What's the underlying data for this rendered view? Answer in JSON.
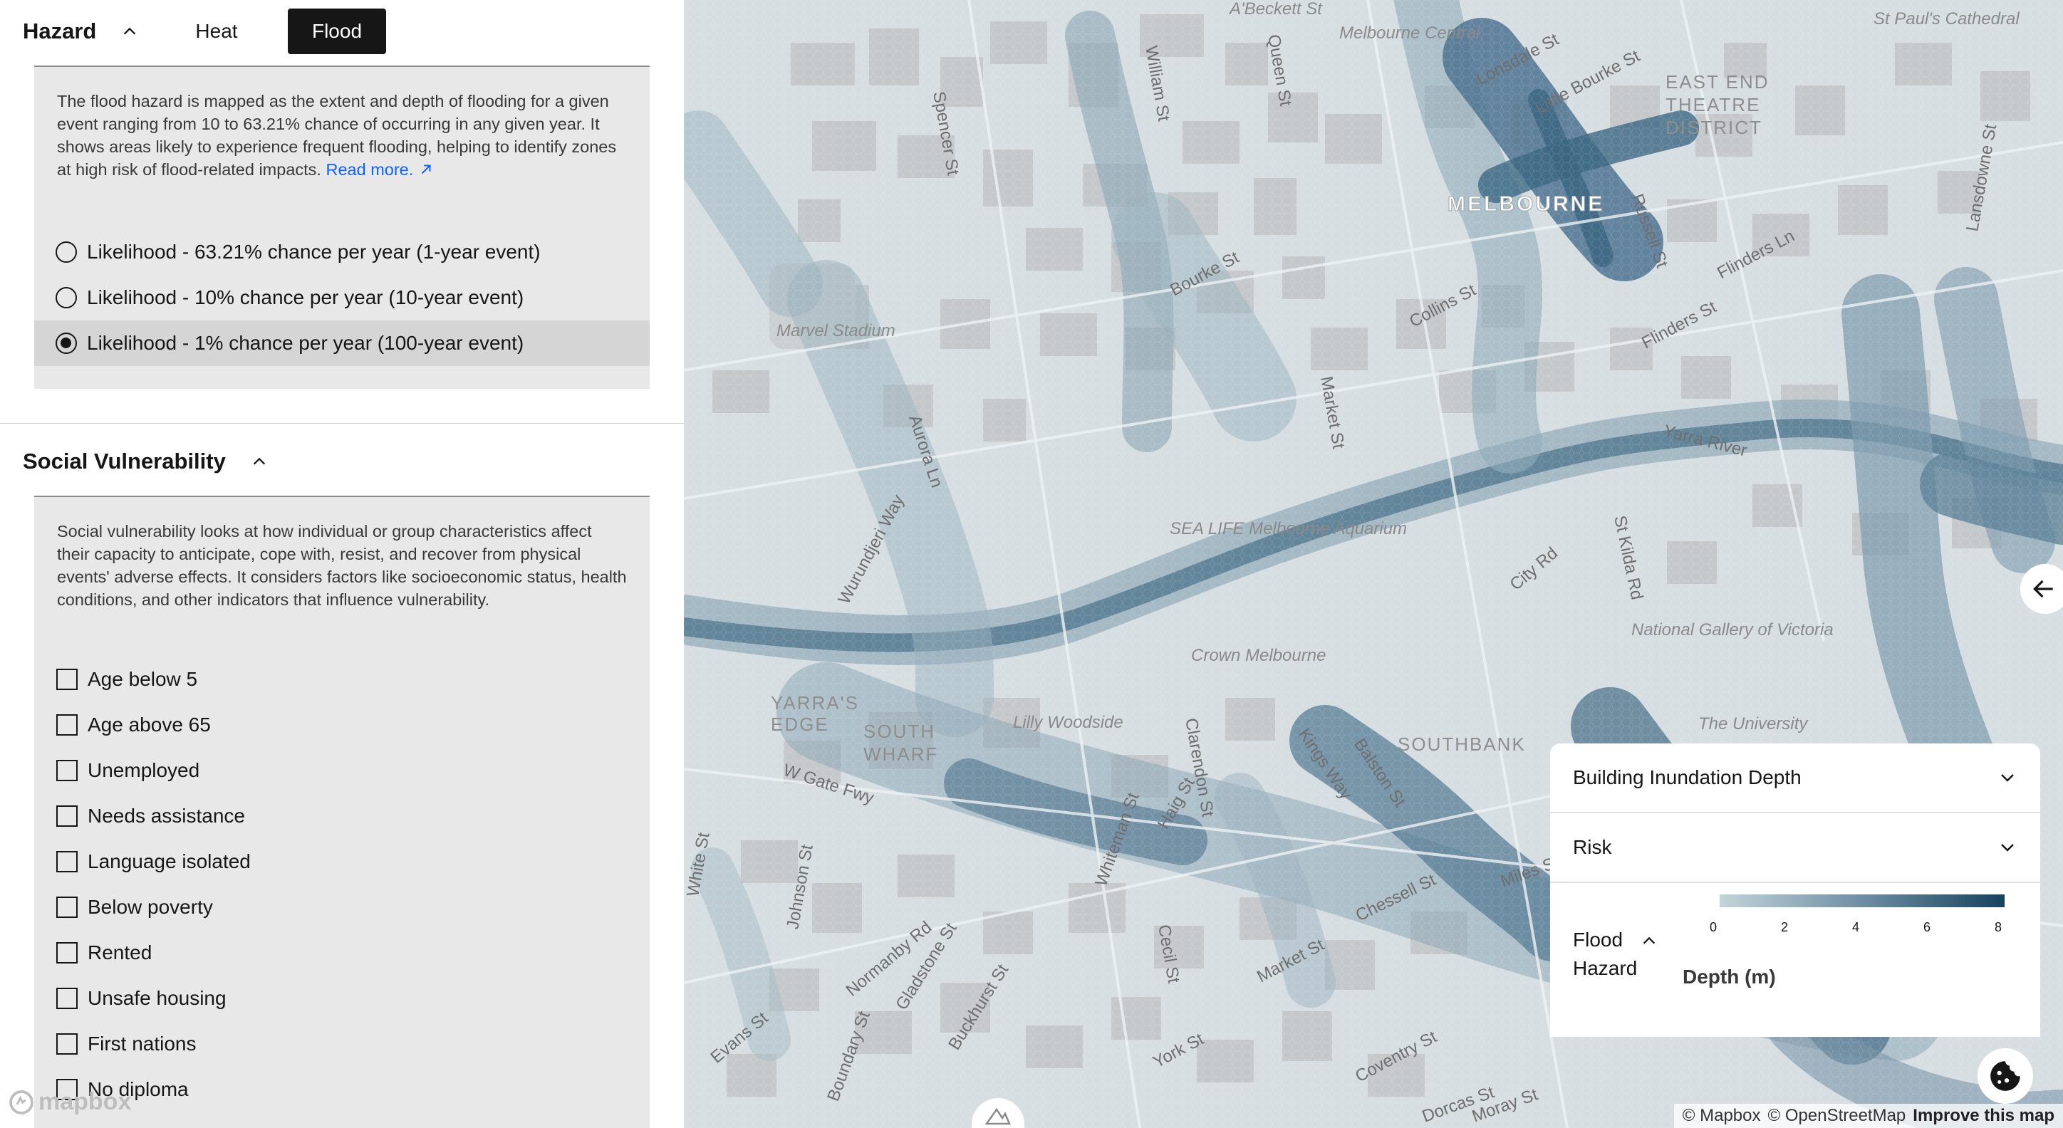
{
  "hazard": {
    "title": "Hazard",
    "tabs": [
      {
        "label": "Heat",
        "active": false
      },
      {
        "label": "Flood",
        "active": true
      }
    ],
    "description": "The flood hazard is mapped as the extent and depth of flooding for a given event ranging from 10 to 63.21% chance of occurring in any given year. It shows areas likely to experience frequent flooding, helping to identify zones at high risk of flood-related impacts.",
    "read_more": "Read more.",
    "options": [
      {
        "label": "Likelihood - 63.21% chance per year (1-year event)",
        "selected": false
      },
      {
        "label": "Likelihood - 10% chance per year (10-year event)",
        "selected": false
      },
      {
        "label": "Likelihood - 1% chance per year (100-year event)",
        "selected": true
      }
    ]
  },
  "social": {
    "title": "Social Vulnerability",
    "description": "Social vulnerability looks at how individual or group characteristics affect their capacity to anticipate, cope with, resist, and recover from physical events' adverse effects. It considers factors like socioeconomic status, health conditions, and other indicators that influence vulnerability.",
    "indicators": [
      {
        "label": "Age below 5",
        "checked": false
      },
      {
        "label": "Age above 65",
        "checked": false
      },
      {
        "label": "Unemployed",
        "checked": false
      },
      {
        "label": "Needs assistance",
        "checked": false
      },
      {
        "label": "Language isolated",
        "checked": false
      },
      {
        "label": "Below poverty",
        "checked": false
      },
      {
        "label": "Rented",
        "checked": false
      },
      {
        "label": "Unsafe housing",
        "checked": false
      },
      {
        "label": "First nations",
        "checked": false
      },
      {
        "label": "No diploma",
        "checked": false
      }
    ]
  },
  "map": {
    "city_label": "MELBOURNE",
    "districts": [
      "EAST END",
      "THEATRE",
      "DISTRICT",
      "SOUTHBANK",
      "YARRA'S",
      "EDGE",
      "SOUTH",
      "WHARF"
    ],
    "streets": [
      "Spencer St",
      "William St",
      "Queen St",
      "Lonsdale St",
      "Little Bourke St",
      "Russell St",
      "Bourke St",
      "Collins St",
      "Flinders Ln",
      "Flinders St",
      "Market St",
      "Aurora Ln",
      "Wurundjeri Way",
      "Yarra River",
      "City Rd",
      "St Kilda Rd",
      "Clarendon St",
      "Kings Way",
      "Balston St",
      "W Gate Fwy",
      "Whiteman St",
      "Haig St",
      "Normanby Rd",
      "Johnson St",
      "Gladstone St",
      "Buckhurst St",
      "Market St",
      "Cecil St",
      "Coventry St",
      "York St",
      "Moray St",
      "Dorcas St",
      "Lansdowne St",
      "Chessell St",
      "Miles St",
      "White St",
      "Boundary St",
      "Evans St"
    ],
    "places": [
      "Marvel Stadium",
      "SEA LIFE Melbourne Aquarium",
      "Crown Melbourne",
      "National Gallery of Victoria",
      "The University",
      "St Paul's Cathedral",
      "Melbourne Central",
      "A'Beckett St",
      "Lilly Woodside"
    ]
  },
  "legend": {
    "rows": [
      {
        "label": "Building Inundation Depth"
      },
      {
        "label": "Risk"
      }
    ],
    "flood_label": "Flood Hazard",
    "unit": "Depth (m)",
    "ticks": [
      "0",
      "2",
      "4",
      "6",
      "8"
    ],
    "scale_range": [
      0,
      8
    ],
    "colors": [
      "#c3d4da",
      "#6e8ea3",
      "#16425e"
    ]
  },
  "attribution": {
    "mapbox": "© Mapbox",
    "osm": "© OpenStreetMap",
    "improve": "Improve this map",
    "logo": "mapbox"
  }
}
